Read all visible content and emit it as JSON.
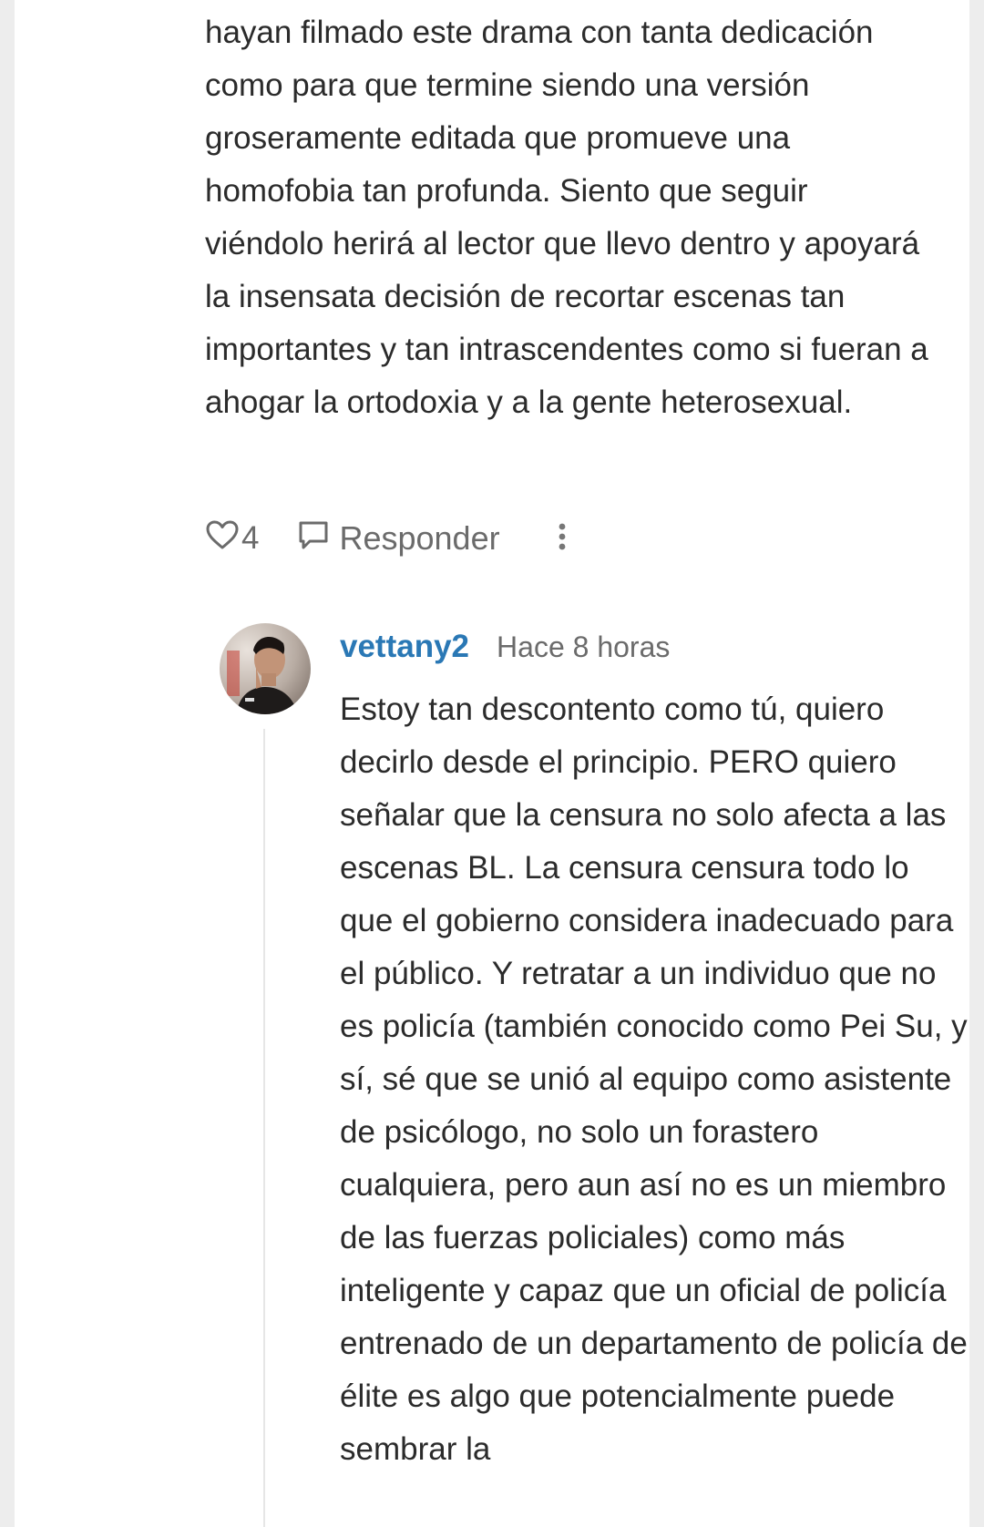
{
  "parent_comment": {
    "text": "hayan filmado este drama con tanta dedicación como para que termine siendo una versión groseramente editada que promueve una homofobia tan profunda. Siento que seguir viéndolo herirá al lector que llevo dentro y apoyará la insensata decisión de recortar escenas tan importantes y tan intrascendentes como si fueran a ahogar la ortodoxia y a la gente heterosexual.",
    "likes": "4",
    "reply_label": "Responder",
    "like_icon": "heart-outline-icon",
    "reply_icon": "speech-bubble-icon",
    "more_icon": "vertical-dots-icon"
  },
  "reply": {
    "username": "vettany2",
    "timestamp": "Hace 8 horas",
    "text": "Estoy tan descontento como tú, quiero decirlo desde el principio. PERO quiero señalar que la censura no solo afecta a las escenas BL. La censura censura todo lo que el gobierno considera inadecuado para el público. Y retratar a un individuo que no es policía (también conocido como Pei Su, y sí, sé que se unió al equipo como asistente de psicólogo, no solo un forastero cualquiera, pero aun así no es un miembro de las fuerzas policiales) como más inteligente y capaz que un oficial de policía entrenado de un departamento de policía de élite es algo que potencialmente puede sembrar la"
  },
  "colors": {
    "background": "#ededed",
    "card": "#ffffff",
    "text": "#2b2b2b",
    "muted": "#6b6b6b",
    "username": "#2a78b5"
  }
}
